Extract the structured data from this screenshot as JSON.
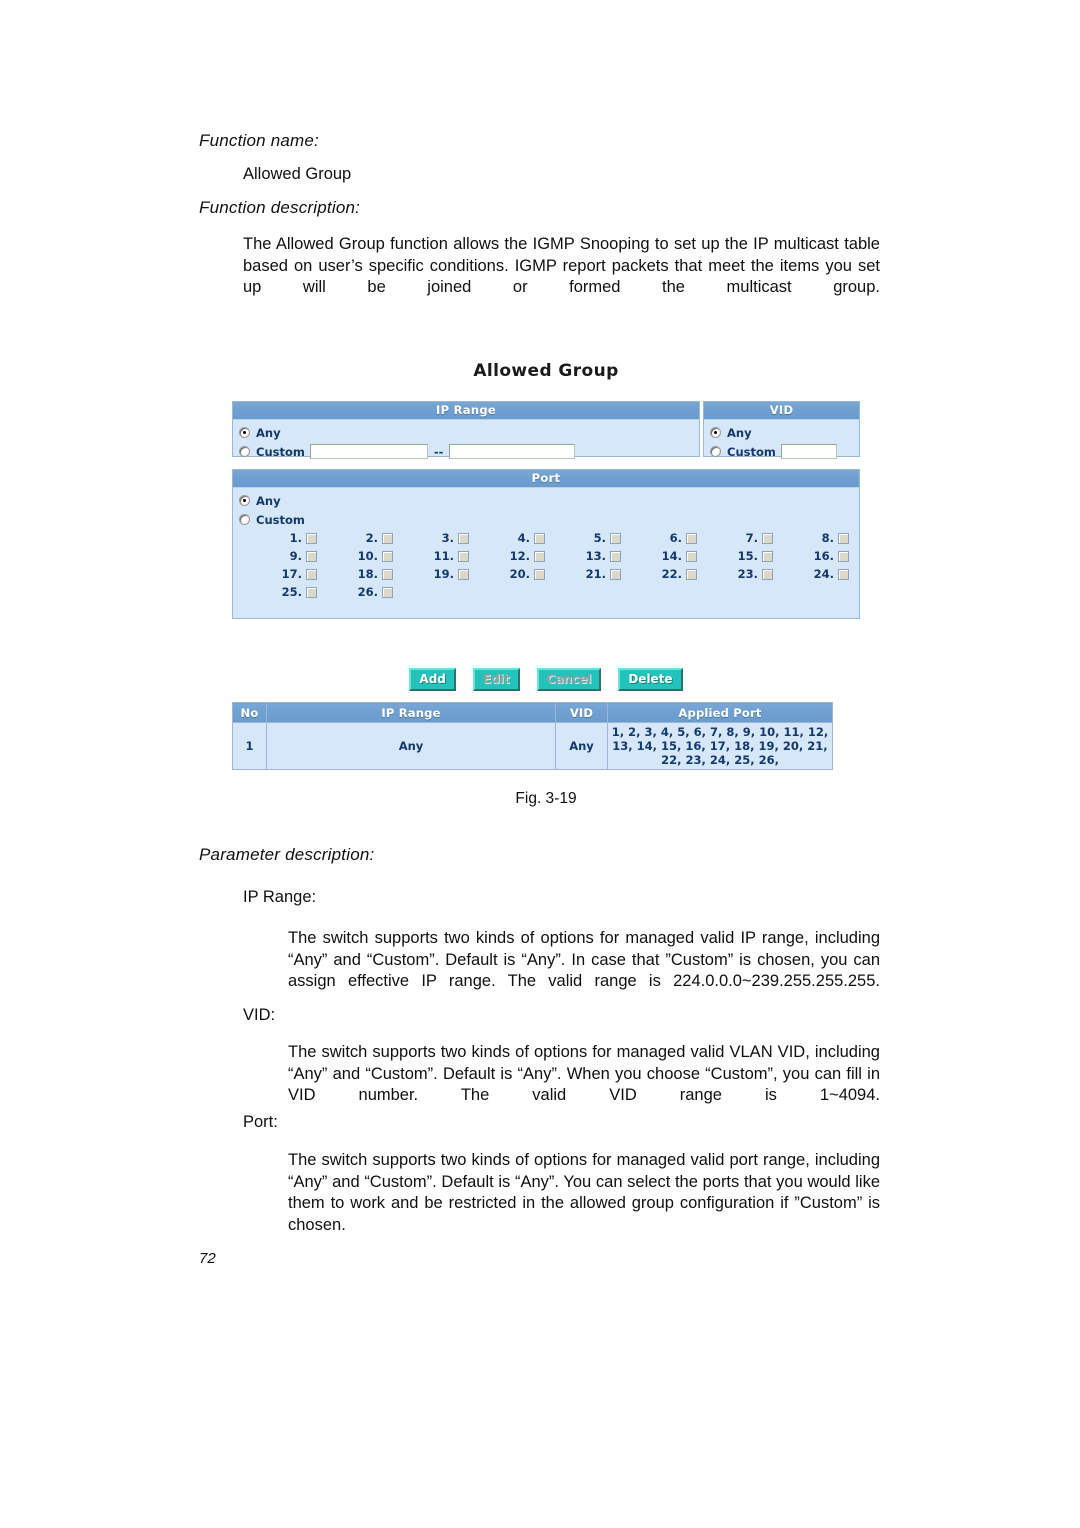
{
  "document": {
    "function_name_heading": "Function name:",
    "function_name_value": "Allowed Group",
    "function_description_heading": "Function description:",
    "function_description_text": "The Allowed Group function allows the IGMP Snooping to set up the IP multicast table based on user’s specific conditions. IGMP report packets that meet the items you set up will be joined or formed the multicast group.",
    "figure_caption": "Fig. 3-19",
    "parameter_description_heading": "Parameter description:",
    "parameters": [
      {
        "term": "IP Range:",
        "text": "The switch supports two kinds of options for managed valid IP range, including “Any” and “Custom”. Default is “Any”. In case that ”Custom” is chosen, you can assign effective IP range. The valid range is 224.0.0.0~239.255.255.255."
      },
      {
        "term": "VID:",
        "text": "The switch supports two kinds of options for managed valid VLAN VID, including “Any” and “Custom”. Default is “Any”. When you choose “Custom”, you can fill in VID number. The valid VID range is 1~4094."
      },
      {
        "term": "Port:",
        "text": "The switch supports two kinds of options for managed valid port range, including “Any” and “Custom”. Default is “Any”. You can select the ports that you would like them to work and be restricted in the allowed group configuration if ”Custom” is chosen."
      }
    ],
    "page_number": "72"
  },
  "screenshot": {
    "title": "Allowed Group",
    "ip_range_panel": {
      "header": "IP Range",
      "any_label": "Any",
      "any_selected": true,
      "custom_label": "Custom",
      "custom_selected": false,
      "start_value": "",
      "start_placeholder": "",
      "separator": "--",
      "end_value": "",
      "end_placeholder": ""
    },
    "vid_panel": {
      "header": "VID",
      "any_label": "Any",
      "any_selected": true,
      "custom_label": "Custom",
      "custom_selected": false,
      "custom_value": "",
      "custom_placeholder": ""
    },
    "port_panel": {
      "header": "Port",
      "any_label": "Any",
      "any_selected": true,
      "custom_label": "Custom",
      "custom_selected": false,
      "ports": [
        {
          "number": "1.",
          "checked": false
        },
        {
          "number": "2.",
          "checked": false
        },
        {
          "number": "3.",
          "checked": false
        },
        {
          "number": "4.",
          "checked": false
        },
        {
          "number": "5.",
          "checked": false
        },
        {
          "number": "6.",
          "checked": false
        },
        {
          "number": "7.",
          "checked": false
        },
        {
          "number": "8.",
          "checked": false
        },
        {
          "number": "9.",
          "checked": false
        },
        {
          "number": "10.",
          "checked": false
        },
        {
          "number": "11.",
          "checked": false
        },
        {
          "number": "12.",
          "checked": false
        },
        {
          "number": "13.",
          "checked": false
        },
        {
          "number": "14.",
          "checked": false
        },
        {
          "number": "15.",
          "checked": false
        },
        {
          "number": "16.",
          "checked": false
        },
        {
          "number": "17.",
          "checked": false
        },
        {
          "number": "18.",
          "checked": false
        },
        {
          "number": "19.",
          "checked": false
        },
        {
          "number": "20.",
          "checked": false
        },
        {
          "number": "21.",
          "checked": false
        },
        {
          "number": "22.",
          "checked": false
        },
        {
          "number": "23.",
          "checked": false
        },
        {
          "number": "24.",
          "checked": false
        },
        {
          "number": "25.",
          "checked": false
        },
        {
          "number": "26.",
          "checked": false
        }
      ]
    },
    "buttons": [
      {
        "label": "Add",
        "enabled": true
      },
      {
        "label": "Edit",
        "enabled": false
      },
      {
        "label": "Cancel",
        "enabled": false
      },
      {
        "label": "Delete",
        "enabled": true
      }
    ],
    "result_table": {
      "columns": [
        "No",
        "IP Range",
        "VID",
        "Applied Port"
      ],
      "rows": [
        {
          "no": "1",
          "ip_range": "Any",
          "vid": "Any",
          "applied_port": "1, 2, 3, 4, 5, 6, 7, 8, 9, 10, 11, 12, 13, 14, 15, 16, 17, 18, 19, 20, 21, 22, 23, 24, 25, 26,"
        }
      ]
    },
    "colors": {
      "panel_header": "#6e9fd0",
      "panel_body": "#d6e7fa",
      "panel_border": "#9cb7d4",
      "label_text": "#14386b",
      "button_face": "#23c3bc",
      "button_text": "#ffffff",
      "button_disabled_text": "#8f9f9e",
      "checkbox_face": "#ded8c8"
    }
  }
}
